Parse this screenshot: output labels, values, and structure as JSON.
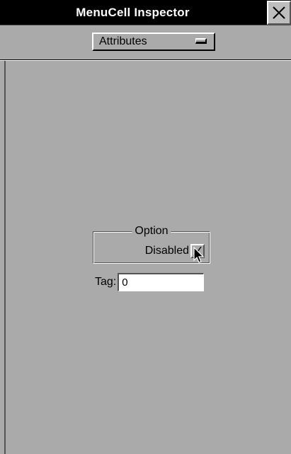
{
  "window": {
    "title": "MenuCell Inspector",
    "close_icon": "close-icon"
  },
  "toolbar": {
    "popup_selected": "Attributes",
    "popup_icon": "popup-indicator-icon"
  },
  "options_group": {
    "legend": "Option",
    "disabled_label": "Disabled",
    "disabled_checked": true,
    "checkbox_icon": "checkmark-icon"
  },
  "tag": {
    "label": "Tag:",
    "value": "0"
  },
  "cursor": {
    "icon": "mouse-pointer-icon"
  },
  "colors": {
    "window_bg": "#aaaaaa",
    "titlebar_bg": "#000000",
    "titlebar_text": "#ffffff",
    "field_bg": "#ffffff"
  }
}
